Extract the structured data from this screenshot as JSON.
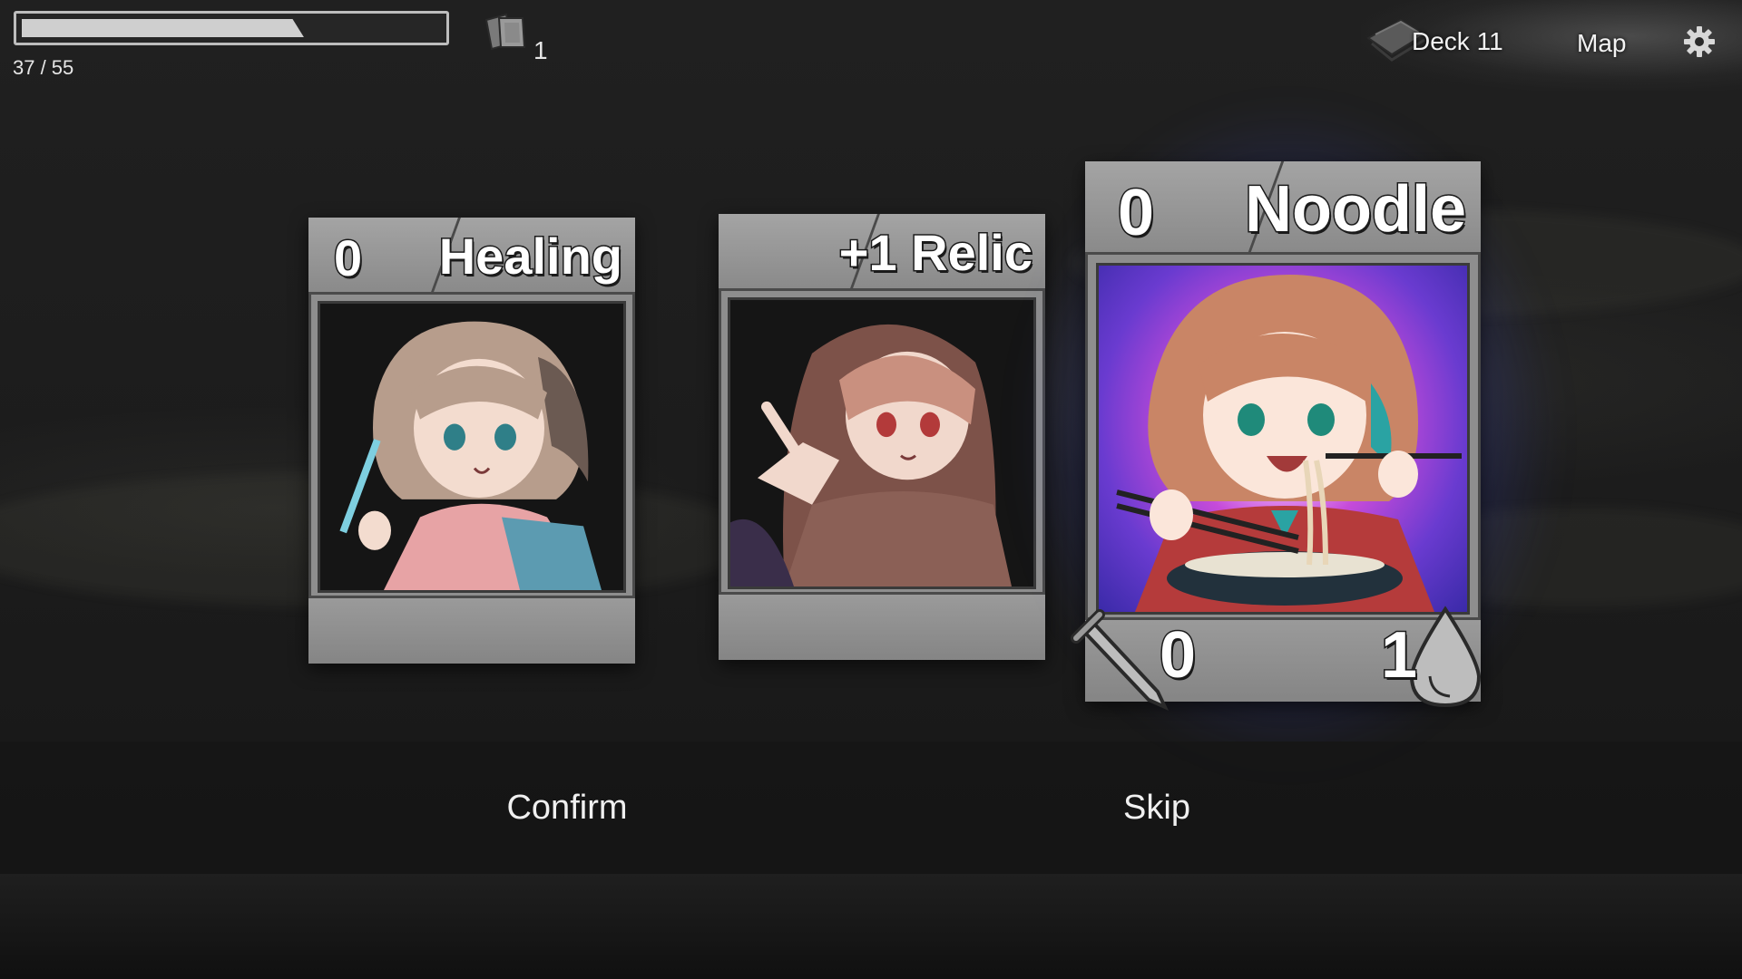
{
  "hud": {
    "progress_text": "37 / 55",
    "progress_fraction": 0.673,
    "relic_count": "1",
    "deck_label": "Deck 11",
    "map_label": "Map",
    "icons": {
      "relic": "card-stack-icon",
      "deck": "deck-icon",
      "settings": "gear-icon"
    }
  },
  "cards": [
    {
      "cost": "0",
      "name": "Healing",
      "art": "nurse-girl-with-syringe"
    },
    {
      "cost": "",
      "name": "+1 Relic",
      "art": "hooded-girl-pointing"
    },
    {
      "cost": "0",
      "name": "Noodle",
      "art": "girl-eating-noodles",
      "attack": "0",
      "health": "1",
      "selected": true
    }
  ],
  "actions": {
    "confirm_label": "Confirm",
    "skip_label": "Skip"
  },
  "colors": {
    "selected_glow": "#c64bd9",
    "card_frame": "#8e8e8e",
    "background": "#1c1c1c"
  }
}
